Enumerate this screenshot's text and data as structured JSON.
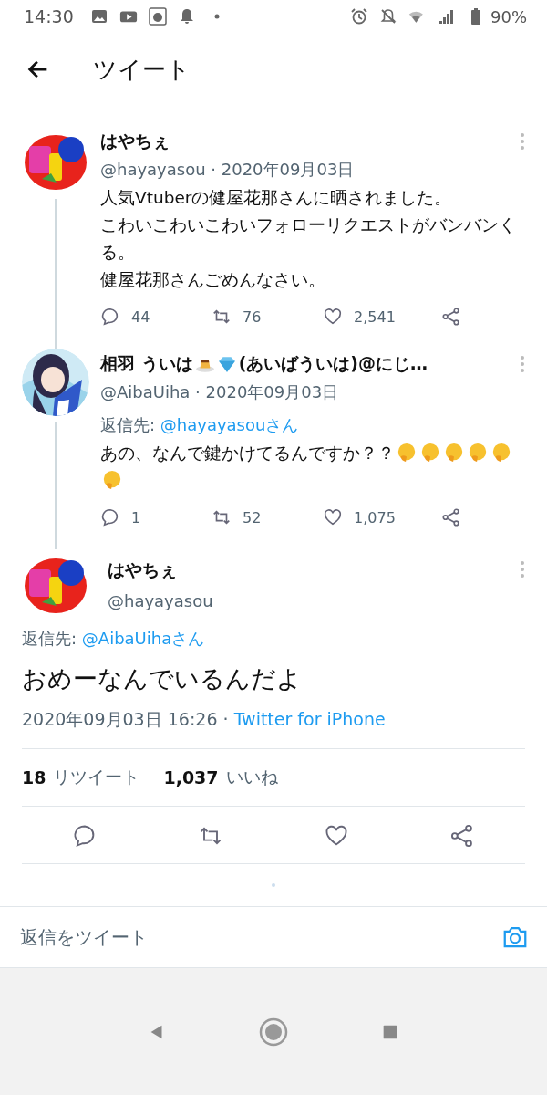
{
  "status_bar": {
    "time": "14:30",
    "battery": "90%"
  },
  "header": {
    "title": "ツイート"
  },
  "thread": [
    {
      "kind": "logo",
      "name_parts": [
        {
          "kind": "text",
          "text": "はやちぇ"
        }
      ],
      "meta": "@hayayasou · 2020年09月03日",
      "body_lines": [
        "人気Vtuberの健屋花那さんに晒されました。",
        "こわいこわいこわいフォローリクエストがバンバンくる。",
        "健屋花那さんごめんなさい。"
      ],
      "replies": "44",
      "retweets": "76",
      "likes": "2,541"
    },
    {
      "kind": "character",
      "name_parts": [
        {
          "kind": "text",
          "text": "相羽 ういは"
        },
        {
          "kind": "pudding"
        },
        {
          "kind": "diamond"
        },
        {
          "kind": "text",
          "text": "(あいばういは)@にじ…"
        }
      ],
      "meta": "@AibaUiha · 2020年09月03日",
      "reply_to": {
        "label": "返信先:",
        "link": "@hayayasouさん"
      },
      "body_lines": [
        "あの、なんで鍵かけてるんですか？？"
      ],
      "emojis": [
        {
          "kind": "thinking"
        },
        {
          "kind": "thinking"
        },
        {
          "kind": "thinking"
        },
        {
          "kind": "thinking"
        },
        {
          "kind": "thinking"
        },
        {
          "kind": "thinking"
        }
      ],
      "replies": "1",
      "retweets": "52",
      "likes": "1,075"
    }
  ],
  "main_tweet": {
    "name": "はやちぇ",
    "handle": "@hayayasou",
    "reply_to": {
      "label": "返信先:",
      "link": "@AibaUihaさん"
    },
    "body": "おめーなんでいるんだよ",
    "timestamp": "2020年09月03日 16:26 ·",
    "source": "Twitter for iPhone",
    "retweet_count": "18",
    "retweet_label": "リツイート",
    "like_count": "1,037",
    "like_label": "いいね"
  },
  "reply_bar": {
    "placeholder": "返信をツイート"
  }
}
